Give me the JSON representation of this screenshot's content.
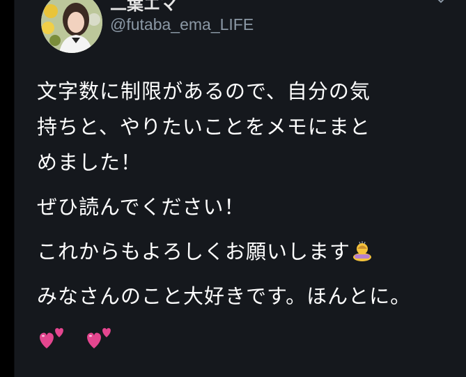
{
  "tweet": {
    "display_name": "二葉エマ",
    "handle": "@futaba_ema_LIFE",
    "text_lines": [
      "文字数に制限があるので、自分の気",
      "持ちと、やりたいことをメモにまと",
      "めました！"
    ],
    "para2": "ぜひ読んでください！",
    "para3": "これからもよろしくお願いします",
    "para3_emoji": "person-bowing-icon",
    "para4": "みなさんのこと大好きです。ほんとに。",
    "para5_emoji": [
      "two-hearts-icon",
      "two-hearts-icon"
    ]
  },
  "colors": {
    "background": "#15181d",
    "text": "#ffffff",
    "secondary_text": "#8b98a5",
    "heart": "#e4468f"
  }
}
